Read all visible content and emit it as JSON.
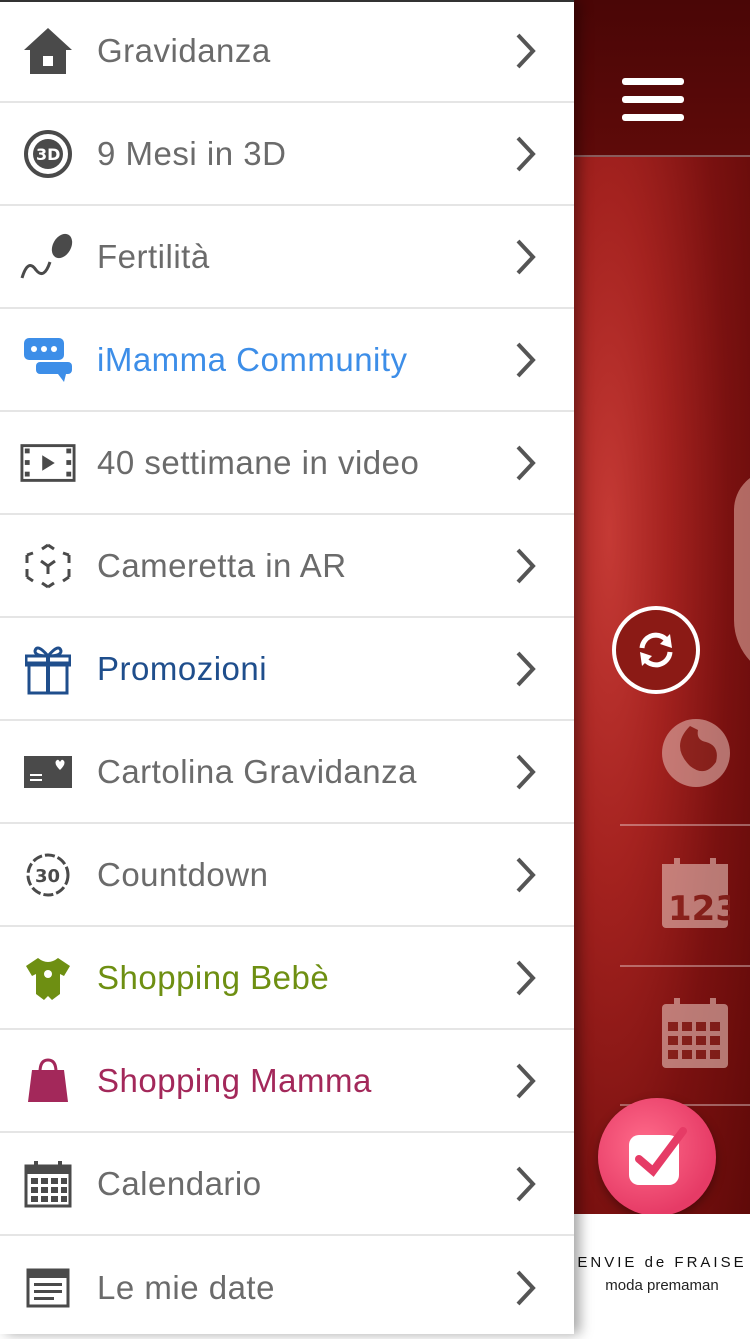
{
  "menu": {
    "items": [
      {
        "label": "Gravidanza",
        "icon": "home-icon",
        "color": "#6b6b6b"
      },
      {
        "label": "9 Mesi in 3D",
        "icon": "3d-icon",
        "color": "#6b6b6b"
      },
      {
        "label": "Fertilità",
        "icon": "sperm-icon",
        "color": "#6b6b6b"
      },
      {
        "label": "iMamma Community",
        "icon": "chat-icon",
        "color": "#3d8ee8"
      },
      {
        "label": "40 settimane in video",
        "icon": "film-icon",
        "color": "#6b6b6b"
      },
      {
        "label": "Cameretta in AR",
        "icon": "ar-cube-icon",
        "color": "#6b6b6b"
      },
      {
        "label": "Promozioni",
        "icon": "gift-icon",
        "color": "#1f4e8c"
      },
      {
        "label": "Cartolina Gravidanza",
        "icon": "postcard-icon",
        "color": "#6b6b6b"
      },
      {
        "label": "Countdown",
        "icon": "countdown-icon",
        "color": "#6b6b6b"
      },
      {
        "label": "Shopping Bebè",
        "icon": "baby-bodysuit-icon",
        "color": "#6e8f12"
      },
      {
        "label": "Shopping Mamma",
        "icon": "shopping-bag-icon",
        "color": "#a3285a"
      },
      {
        "label": "Calendario",
        "icon": "calendar-icon",
        "color": "#6b6b6b"
      },
      {
        "label": "Le mie date",
        "icon": "list-icon",
        "color": "#6b6b6b"
      }
    ]
  },
  "brand": {
    "name": "ENVIE de FRAISE",
    "tagline": "moda premaman"
  },
  "side_icons": [
    "refresh-icon",
    "pregnant-icon",
    "calendar-123-icon",
    "calendar-grid-icon"
  ]
}
